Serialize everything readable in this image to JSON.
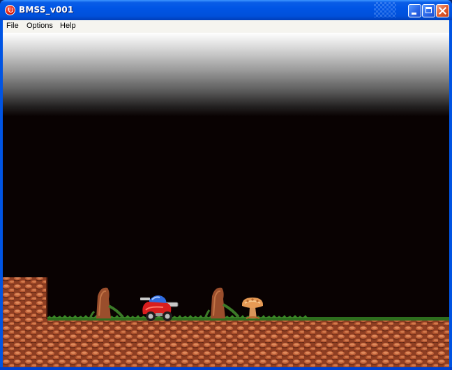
{
  "window": {
    "title": "BMSS_v001",
    "controls": {
      "minimize_icon": "minimize-icon",
      "maximize_icon": "maximize-icon",
      "close_icon": "close-icon"
    }
  },
  "menubar": {
    "items": [
      "File",
      "Options",
      "Help"
    ]
  },
  "colors": {
    "titlebar": "#0055E5",
    "game_background": "#090202",
    "dirt": "#A04A2C",
    "grass": "#2E6E1E",
    "buggy_body": "#E02020",
    "buggy_dome": "#3070E0"
  },
  "game": {
    "scene": [
      "dirt-ground",
      "dirt-ledge",
      "tree-stump",
      "tree-stump",
      "buggy-player",
      "mushroom-enemy"
    ]
  }
}
